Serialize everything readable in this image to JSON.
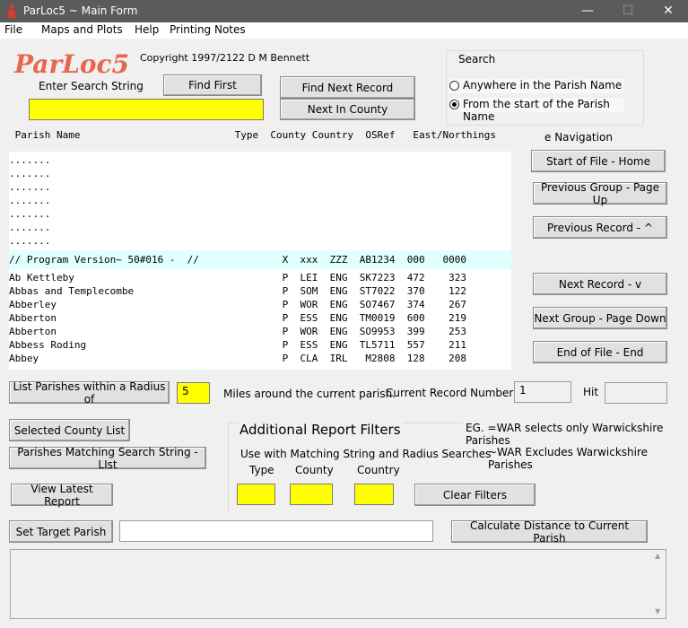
{
  "window": {
    "title": "ParLoc5 ~ Main Form",
    "minimize": "—",
    "maximize": "☐",
    "close": "✕"
  },
  "menu": [
    {
      "label": "File"
    },
    {
      "label": "Maps and Plots"
    },
    {
      "label": "Help"
    },
    {
      "label": "Printing Notes"
    }
  ],
  "logo": "ParLoc5",
  "copyright": "Copyright 1997/2122 D M Bennett",
  "search": {
    "enter_label": "Enter Search String",
    "value": "",
    "find_first": "Find First",
    "find_next": "Find Next Record",
    "next_county": "Next In County",
    "group_label": "Search",
    "option_anywhere": "Anywhere in the Parish Name",
    "option_start": "From the start of the Parish Name",
    "selected": "start"
  },
  "list": {
    "header": " Parish Name                          Type  County Country  OSRef   East/Northings",
    "rows": [
      ".......",
      ".......",
      ".......",
      ".......",
      ".......",
      ".......",
      ".......",
      "// Program Version~ 50#016 -  //              X  xxx  ZZZ  AB1234  000   0000",
      "Ab Kettleby                                   P  LEI  ENG  SK7223  472    323",
      "Abbas and Templecombe                         P  SOM  ENG  ST7022  370    122",
      "Abberley                                      P  WOR  ENG  SO7467  374    267",
      "Abberton                                      P  ESS  ENG  TM0019  600    219",
      "Abberton                                      P  WOR  ENG  SO9953  399    253",
      "Abbess Roding                                 P  ESS  ENG  TL5711  557    211",
      "Abbey                                         P  CLA  IRL   M2808  128    208"
    ]
  },
  "navigation": {
    "label": "e Navigation",
    "start": "Start of File - Home",
    "prev_group": "Previous Group - Page Up",
    "prev_record": "Previous Record - ^",
    "next_record": "Next Record - v",
    "next_group": "Next Group  - Page Down",
    "end": "End of File - End"
  },
  "radius": {
    "button": "List Parishes within a Radius of",
    "value": "5",
    "miles_label": "Miles around the current parish.",
    "current_label": "Current Record Number",
    "current_value": "1",
    "hit_label": "Hit",
    "hit_value": ""
  },
  "reports": {
    "selected_county": "Selected County List",
    "matching": "Parishes Matching Search String - LIst",
    "view_latest": "View Latest Report"
  },
  "filters": {
    "title": "Additional Report Filters",
    "subtitle": "Use with Matching String and Radius Searches",
    "type_label": "Type",
    "county_label": "County",
    "country_label": "Country",
    "type_value": "",
    "county_value": "",
    "country_value": "",
    "clear": "Clear Filters",
    "eg1": "EG.  =WAR selects only Warwickshire Parishes",
    "eg2": "~WAR Excludes Warwickshire Parishes"
  },
  "target": {
    "set_button": "Set Target Parish",
    "value": "",
    "calc_button": "Calculate Distance to Current Parish",
    "output": ""
  }
}
